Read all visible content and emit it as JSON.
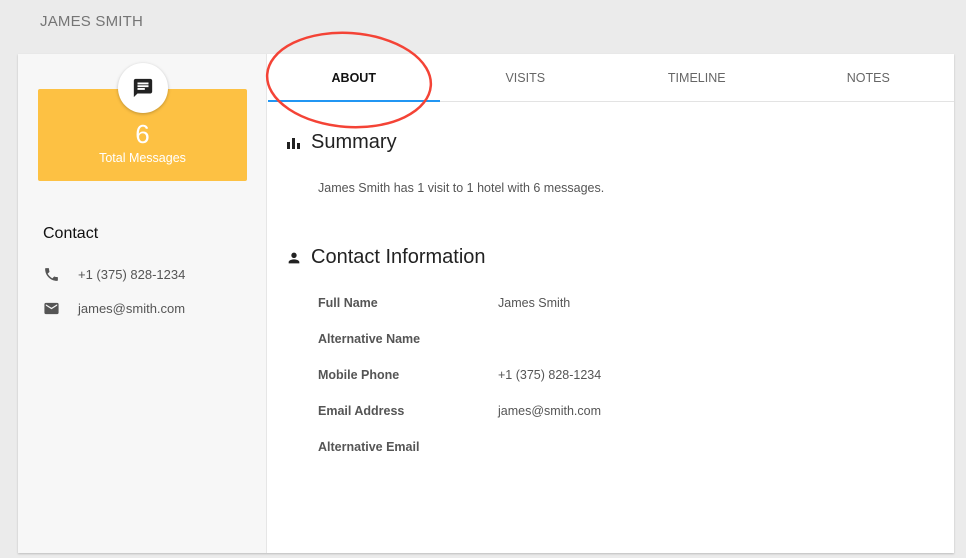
{
  "header": {
    "title": "JAMES SMITH"
  },
  "stat": {
    "value": "6",
    "label": "Total Messages",
    "icon": "message-icon"
  },
  "contact": {
    "heading": "Contact",
    "phone": "+1 (375) 828-1234",
    "email": "james@smith.com"
  },
  "tabs": [
    {
      "label": "ABOUT",
      "active": true
    },
    {
      "label": "VISITS"
    },
    {
      "label": "TIMELINE"
    },
    {
      "label": "NOTES"
    }
  ],
  "summary": {
    "heading": "Summary",
    "text": "James Smith has 1 visit to 1 hotel with 6 messages."
  },
  "contact_info": {
    "heading": "Contact Information",
    "fields": [
      {
        "label": "Full Name",
        "value": "James Smith"
      },
      {
        "label": "Alternative Name",
        "value": ""
      },
      {
        "label": "Mobile Phone",
        "value": "+1 (375) 828-1234"
      },
      {
        "label": "Email Address",
        "value": "james@smith.com"
      },
      {
        "label": "Alternative Email",
        "value": ""
      }
    ]
  },
  "colors": {
    "accent": "#2196f3",
    "stat_bg": "#fdc143",
    "annotation": "#f44336"
  }
}
